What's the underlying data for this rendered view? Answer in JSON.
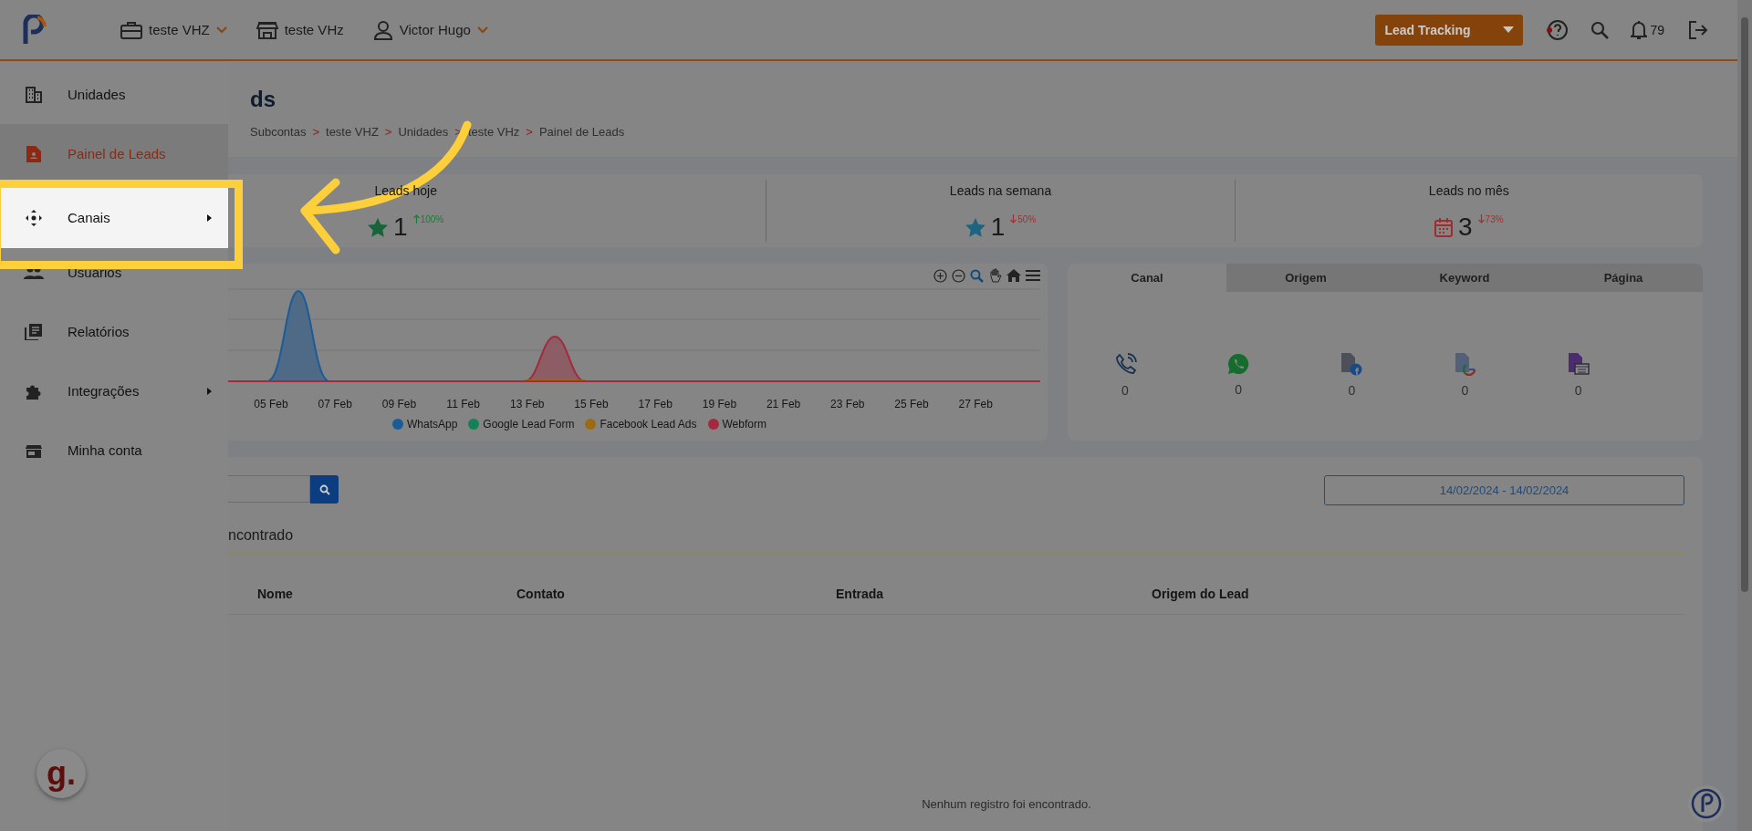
{
  "topbar": {
    "menus": [
      {
        "label": "teste VHZ",
        "dropdown": true
      },
      {
        "label": "teste VHz",
        "dropdown": false
      },
      {
        "label": "Victor Hugo",
        "dropdown": true
      }
    ],
    "product_select": "Lead Tracking",
    "notifications": "79"
  },
  "sidebar": {
    "items": [
      {
        "label": "Unidades",
        "selected": false,
        "submenu": false,
        "highlighted": false
      },
      {
        "label": "Painel de Leads",
        "selected": true,
        "submenu": false,
        "highlighted": false
      },
      {
        "label": "Canais",
        "selected": false,
        "submenu": true,
        "highlighted": true
      },
      {
        "label": "Usuários",
        "selected": false,
        "submenu": false,
        "highlighted": false
      },
      {
        "label": "Relatórios",
        "selected": false,
        "submenu": false,
        "highlighted": false
      },
      {
        "label": "Integrações",
        "selected": false,
        "submenu": true,
        "highlighted": false
      },
      {
        "label": "Minha conta",
        "selected": false,
        "submenu": false,
        "highlighted": false
      }
    ],
    "widget": "g."
  },
  "page": {
    "title": "ds",
    "breadcrumb": {
      "separator": ">",
      "items": [
        "Subcontas",
        "teste VHZ",
        "Unidades",
        "teste VHz",
        "Painel de Leads"
      ]
    }
  },
  "stats": [
    {
      "label": "Leads hoje",
      "value": "1",
      "change": "100%",
      "rising": true
    },
    {
      "label": "Leads na semana",
      "value": "1",
      "change": "50%",
      "rising": false
    },
    {
      "label": "Leads no mês",
      "value": "3",
      "change": "73%",
      "rising": false
    }
  ],
  "chart": {
    "x_labels": [
      "05 Feb",
      "07 Feb",
      "09 Feb",
      "11 Feb",
      "13 Feb",
      "15 Feb",
      "17 Feb",
      "19 Feb",
      "21 Feb",
      "23 Feb",
      "25 Feb",
      "27 Feb"
    ],
    "legend": [
      {
        "name": "WhatsApp",
        "color": "#1a5c98"
      },
      {
        "name": "Google Lead Form",
        "color": "#138055"
      },
      {
        "name": "Facebook Lead Ads",
        "color": "#9c6a12"
      },
      {
        "name": "Webform",
        "color": "#a32a3c"
      }
    ]
  },
  "channels": {
    "tabs": [
      {
        "label": "Canal",
        "selected": true
      },
      {
        "label": "Origem",
        "selected": false
      },
      {
        "label": "Keyword",
        "selected": false
      },
      {
        "label": "Página",
        "selected": false
      }
    ],
    "items": [
      {
        "count": "0"
      },
      {
        "count": "0"
      },
      {
        "count": "0"
      },
      {
        "count": "0"
      },
      {
        "count": "0"
      }
    ]
  },
  "leads": {
    "date_range": "14/02/2024 - 14/02/2024",
    "heading": "ncontrado",
    "columns": [
      "Nome",
      "Contato",
      "Entrada",
      "Origem do Lead"
    ],
    "empty_message": "Nenhum registro foi encontrado."
  }
}
